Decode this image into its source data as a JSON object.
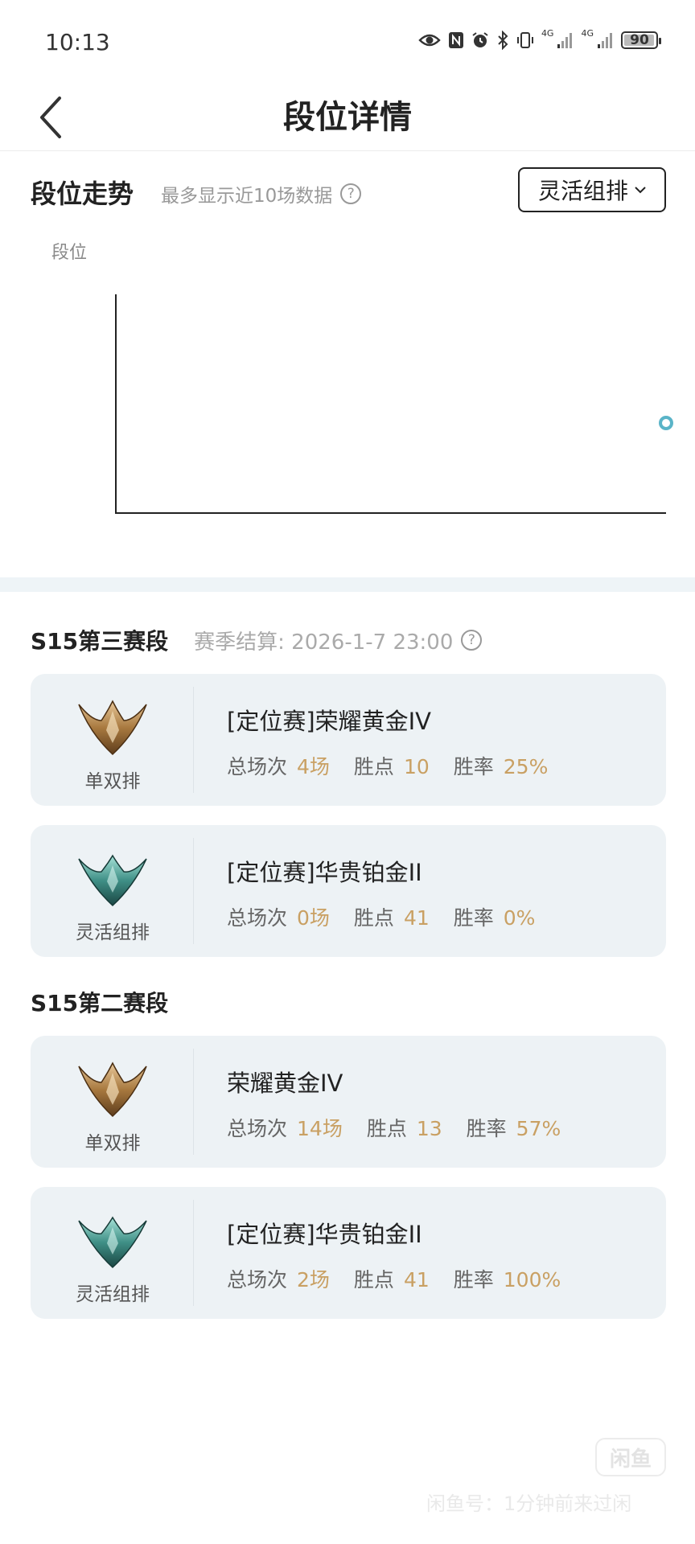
{
  "status_bar": {
    "time": "10:13",
    "network_1": "4G",
    "network_2": "4G",
    "battery": "90"
  },
  "header": {
    "title": "段位详情"
  },
  "trend": {
    "title": "段位走势",
    "subtitle": "最多显示近10场数据",
    "help_glyph": "?",
    "dropdown_value": "灵活组排",
    "y_axis_label": "段位",
    "point_color": "#5ab4c8"
  },
  "chart_data": {
    "type": "line",
    "ylabel": "段位",
    "series": [
      {
        "values": [
          null
        ]
      }
    ]
  },
  "seasons": [
    {
      "title": "S15第三赛段",
      "note": "赛季结算: 2026-1-7 23:00",
      "help_glyph": "?",
      "cards": [
        {
          "queue": "单双排",
          "emblem": "gold-emblem",
          "rank": "[定位赛]荣耀黄金IV",
          "games_label": "总场次",
          "games": "4场",
          "points_label": "胜点",
          "points": "10",
          "winrate_label": "胜率",
          "winrate": "25%"
        },
        {
          "queue": "灵活组排",
          "emblem": "platinum-emblem",
          "rank": "[定位赛]华贵铂金II",
          "games_label": "总场次",
          "games": "0场",
          "points_label": "胜点",
          "points": "41",
          "winrate_label": "胜率",
          "winrate": "0%"
        }
      ]
    },
    {
      "title": "S15第二赛段",
      "cards": [
        {
          "queue": "单双排",
          "emblem": "gold-emblem",
          "rank": "荣耀黄金IV",
          "games_label": "总场次",
          "games": "14场",
          "points_label": "胜点",
          "points": "13",
          "winrate_label": "胜率",
          "winrate": "57%"
        },
        {
          "queue": "灵活组排",
          "emblem": "platinum-emblem",
          "rank": "[定位赛]华贵铂金II",
          "games_label": "总场次",
          "games": "2场",
          "points_label": "胜点",
          "points": "41",
          "winrate_label": "胜率",
          "winrate": "100%"
        }
      ]
    }
  ],
  "watermark": {
    "text": "闲鱼号：1分钟前来过闲",
    "logo": "闲鱼"
  },
  "colors": {
    "accent_value": "#c9a063",
    "divider": "#eef4f7",
    "card_bg": "#edf2f5"
  }
}
